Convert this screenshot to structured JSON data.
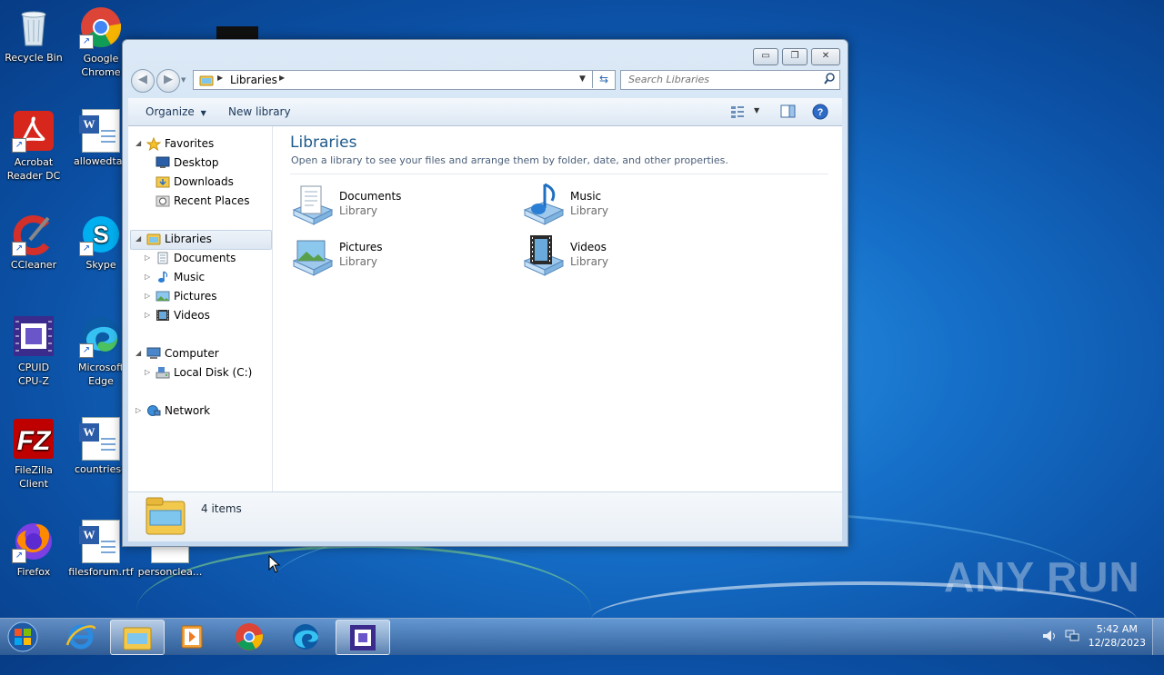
{
  "desktop": {
    "icons": [
      {
        "label": "Recycle Bin"
      },
      {
        "label": "Google Chrome"
      },
      {
        "label": "Acrobat Reader DC"
      },
      {
        "label": "allowedtax"
      },
      {
        "label": "CCleaner"
      },
      {
        "label": "Skype"
      },
      {
        "label": "CPUID CPU-Z"
      },
      {
        "label": "Microsoft Edge"
      },
      {
        "label": "FileZilla Client"
      },
      {
        "label": "countriesg"
      },
      {
        "label": "Firefox"
      },
      {
        "label": "filesforum.rtf"
      },
      {
        "label": "personclea..."
      }
    ],
    "watermark": "ANY RUN"
  },
  "window": {
    "caption_buttons": {
      "minimize": "▭",
      "maximize": "❐",
      "close": "✕"
    },
    "address": {
      "path": "Libraries"
    },
    "search": {
      "placeholder": "Search Libraries"
    },
    "toolbar": {
      "organize": "Organize",
      "new_library": "New library"
    },
    "nav": {
      "favorites": "Favorites",
      "desktop": "Desktop",
      "downloads": "Downloads",
      "recent_places": "Recent Places",
      "libraries": "Libraries",
      "documents": "Documents",
      "music": "Music",
      "pictures": "Pictures",
      "videos": "Videos",
      "computer": "Computer",
      "local_disk": "Local Disk (C:)",
      "network": "Network"
    },
    "main": {
      "title": "Libraries",
      "description": "Open a library to see your files and arrange them by folder, date, and other properties.",
      "items": [
        {
          "name": "Documents",
          "type": "Library"
        },
        {
          "name": "Music",
          "type": "Library"
        },
        {
          "name": "Pictures",
          "type": "Library"
        },
        {
          "name": "Videos",
          "type": "Library"
        }
      ]
    },
    "details": {
      "count": "4 items"
    }
  },
  "taskbar": {
    "clock_time": "5:42 AM",
    "clock_date": "12/28/2023"
  },
  "colors": {
    "accent": "#1e5a8c",
    "selection": "#dde7f2",
    "desktop": "#1670c9"
  }
}
